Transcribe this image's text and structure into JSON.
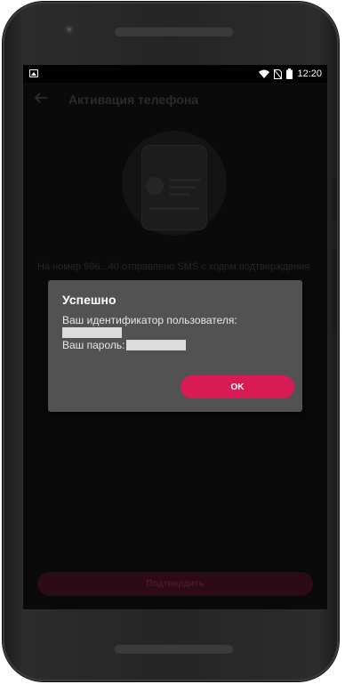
{
  "status_bar": {
    "time": "12:20",
    "icons": [
      "image-icon",
      "wifi-icon",
      "no-sim-icon",
      "battery-icon"
    ]
  },
  "app_bar": {
    "title": "Активация телефона",
    "back_icon": "arrow-back-icon"
  },
  "content": {
    "sms_text": "На номер 996...40 отправлено SMS с кодом подтверждения",
    "confirm_button_label": "Подтвердить"
  },
  "dialog": {
    "title": "Успешно",
    "user_id_label": "Ваш идентификатор пользователя:",
    "password_label": "Ваш пароль:",
    "ok_label": "OK"
  },
  "colors": {
    "accent": "#d81b55",
    "dialog_bg": "#525252",
    "screen_bg": "#0a0a0a"
  }
}
